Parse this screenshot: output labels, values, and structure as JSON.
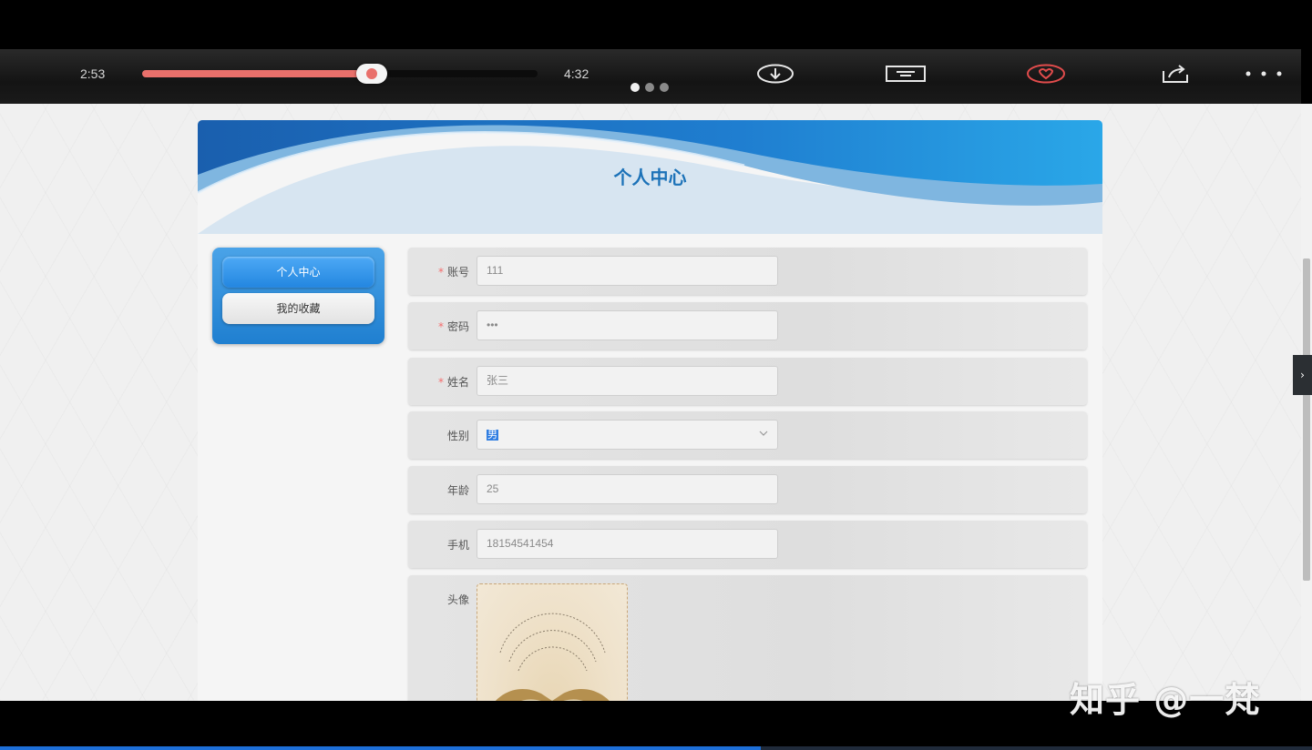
{
  "player": {
    "current_time": "2:53",
    "total_time": "4:32",
    "progress": 0.58,
    "icons": [
      "download-icon",
      "danmaku-icon",
      "favorite-icon",
      "share-icon",
      "more-icon"
    ],
    "pages": 3,
    "active_page": 0,
    "accent": "#e9706b"
  },
  "page": {
    "title": "个人中心",
    "nav": [
      {
        "label": "个人中心",
        "active": true
      },
      {
        "label": "我的收藏",
        "active": false
      }
    ],
    "form": {
      "account": {
        "label": "账号",
        "value": "111",
        "required": true
      },
      "password": {
        "label": "密码",
        "value": "•••",
        "required": true
      },
      "name": {
        "label": "姓名",
        "value": "张三",
        "required": true
      },
      "gender": {
        "label": "性别",
        "value": "男",
        "required": false
      },
      "age": {
        "label": "年龄",
        "value": "25",
        "required": false
      },
      "phone": {
        "label": "手机",
        "value": "18154541454",
        "required": false
      },
      "avatar": {
        "label": "头像"
      }
    },
    "colors": {
      "brand": "#1c72b8",
      "required": "#f56c6c"
    }
  },
  "watermark": "知乎 @一梵",
  "seek_progress": 0.58
}
